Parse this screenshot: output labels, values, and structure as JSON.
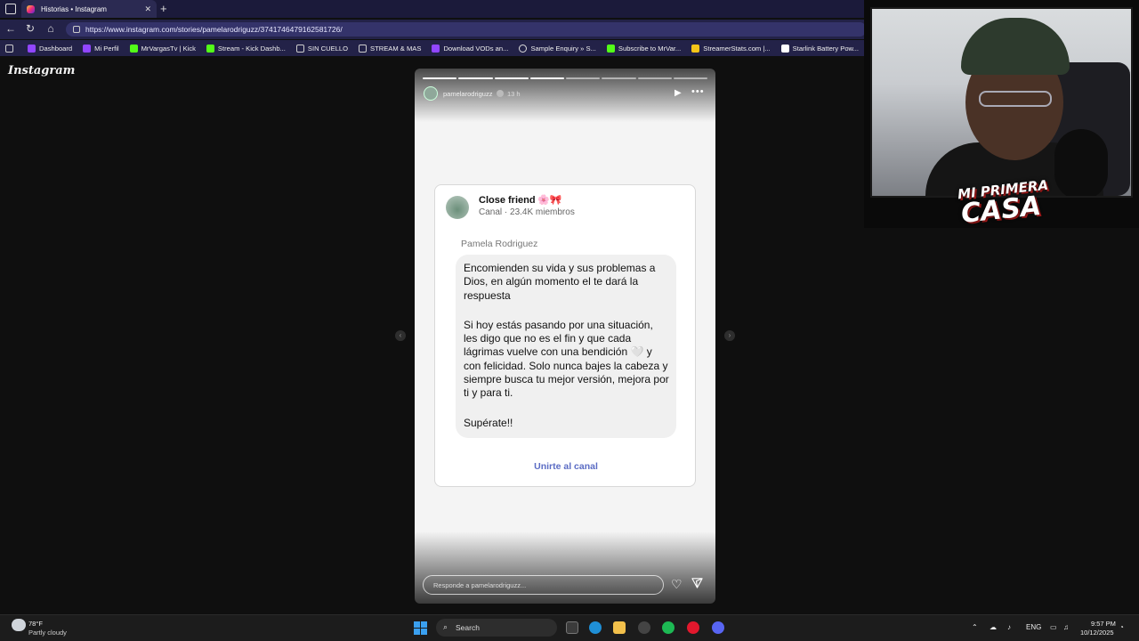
{
  "browser": {
    "tab_title": "Historias • Instagram",
    "tab_close": "✕",
    "new_tab": "+",
    "url": "https://www.instagram.com/stories/pamelarodriguzz/3741746479162581726/",
    "bookmarks": [
      {
        "label": "Dashboard",
        "color": "#9146ff"
      },
      {
        "label": "Mi Perfil",
        "color": "#9146ff"
      },
      {
        "label": "MrVargasTv | Kick",
        "color": "#53fc18"
      },
      {
        "label": "Stream - Kick Dashb...",
        "color": "#53fc18"
      },
      {
        "label": "SIN CUELLO",
        "color": "#cccccc"
      },
      {
        "label": "STREAM & MAS",
        "color": "#cccccc"
      },
      {
        "label": "Download VODs an...",
        "color": "#9146ff"
      },
      {
        "label": "Sample Enquiry » S...",
        "color": "#dddddd"
      },
      {
        "label": "Subscribe to MrVar...",
        "color": "#53fc18"
      },
      {
        "label": "StreamerStats.com |...",
        "color": "#f5c518"
      },
      {
        "label": "Starlink Battery Pow...",
        "color": "#ffffff"
      }
    ]
  },
  "page": {
    "logo": "Instagram"
  },
  "story": {
    "username": "pamelarodriguzz",
    "time": "13 h",
    "progress": {
      "segments": 8,
      "completed": 4
    },
    "card": {
      "channel_name": "Close friend",
      "channel_emoji": "🌸🎀",
      "channel_meta": "Canal · 23.4K miembros",
      "sender": "Pamela Rodriguez",
      "message": [
        "Encomienden su vida y sus problemas a Dios, en algún momento el te dará la respuesta",
        "Si hoy estás pasando por una situación, les digo que no es el fin y que cada lágrimas vuelve con una bendición 🤍 y con felicidad. Solo nunca bajes la cabeza y siempre busca tu mejor versión, mejora por ti y para ti.",
        "Supérate!!"
      ],
      "join_label": "Unirte al canal"
    },
    "reply_placeholder": "Responde a pamelarodriguzz..."
  },
  "webcam": {
    "overlay_line1": "MI PRIMERA",
    "overlay_line2": "CASA"
  },
  "taskbar": {
    "weather_temp": "78°F",
    "weather_cond": "Partly cloudy",
    "search_label": "Search",
    "lang": "ENG",
    "time": "9:57 PM",
    "date": "10/12/2025"
  }
}
